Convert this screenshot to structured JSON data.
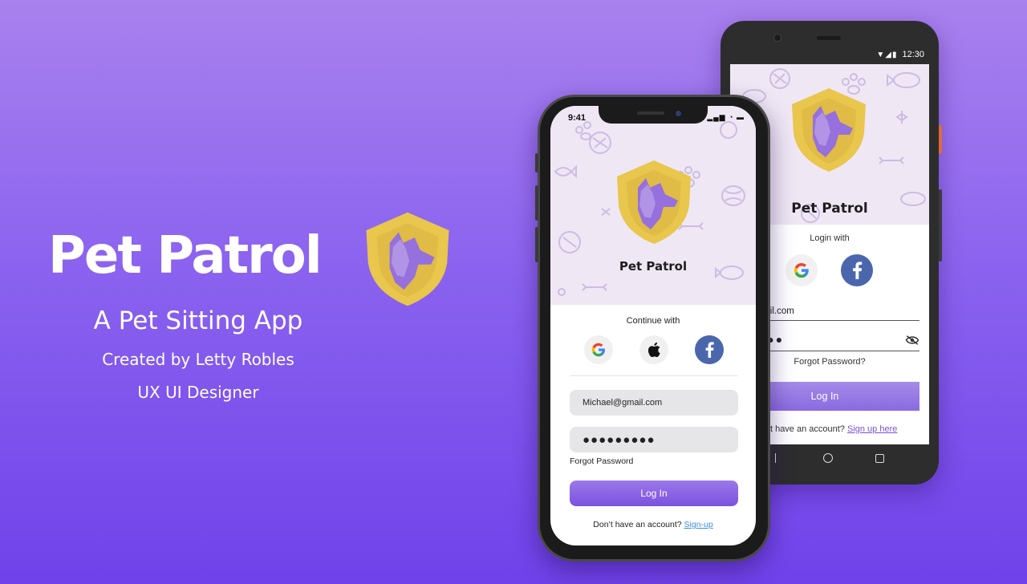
{
  "hero": {
    "title": "Pet Patrol",
    "subtitle": "A Pet Sitting App",
    "credit": "Created by Letty Robles",
    "role": "UX UI Designer"
  },
  "colors": {
    "background_top": "#a981ee",
    "background_bottom": "#6f42ea",
    "shield_gold": "#e9c64c",
    "shield_purple": "#9670dc",
    "button_purple": "#8a6ae0",
    "facebook_blue": "#4a67ad",
    "link_blue": "#3a8fe0"
  },
  "android": {
    "status_time": "12:30",
    "app_title": "Pet Patrol",
    "login_with": "Login with",
    "social": [
      "google-icon",
      "facebook-icon"
    ],
    "email_value": "hael@gmail.com",
    "password_value": "●●●●●●●",
    "forgot_label": "Forgot Password?",
    "login_label": "Log In",
    "signup_prompt": "on't have an account?",
    "signup_link": "Sign up here"
  },
  "iphone": {
    "status_time": "9:41",
    "app_title": "Pet Patrol",
    "continue_with": "Continue with",
    "social": [
      "google-icon",
      "apple-icon",
      "facebook-icon"
    ],
    "email_value": "Michael@gmail.com",
    "password_value": "●●●●●●●●●",
    "forgot_label": "Forgot Password",
    "login_label": "Log In",
    "signup_prompt": "Don’t have an account?",
    "signup_link": "Sign-up"
  }
}
